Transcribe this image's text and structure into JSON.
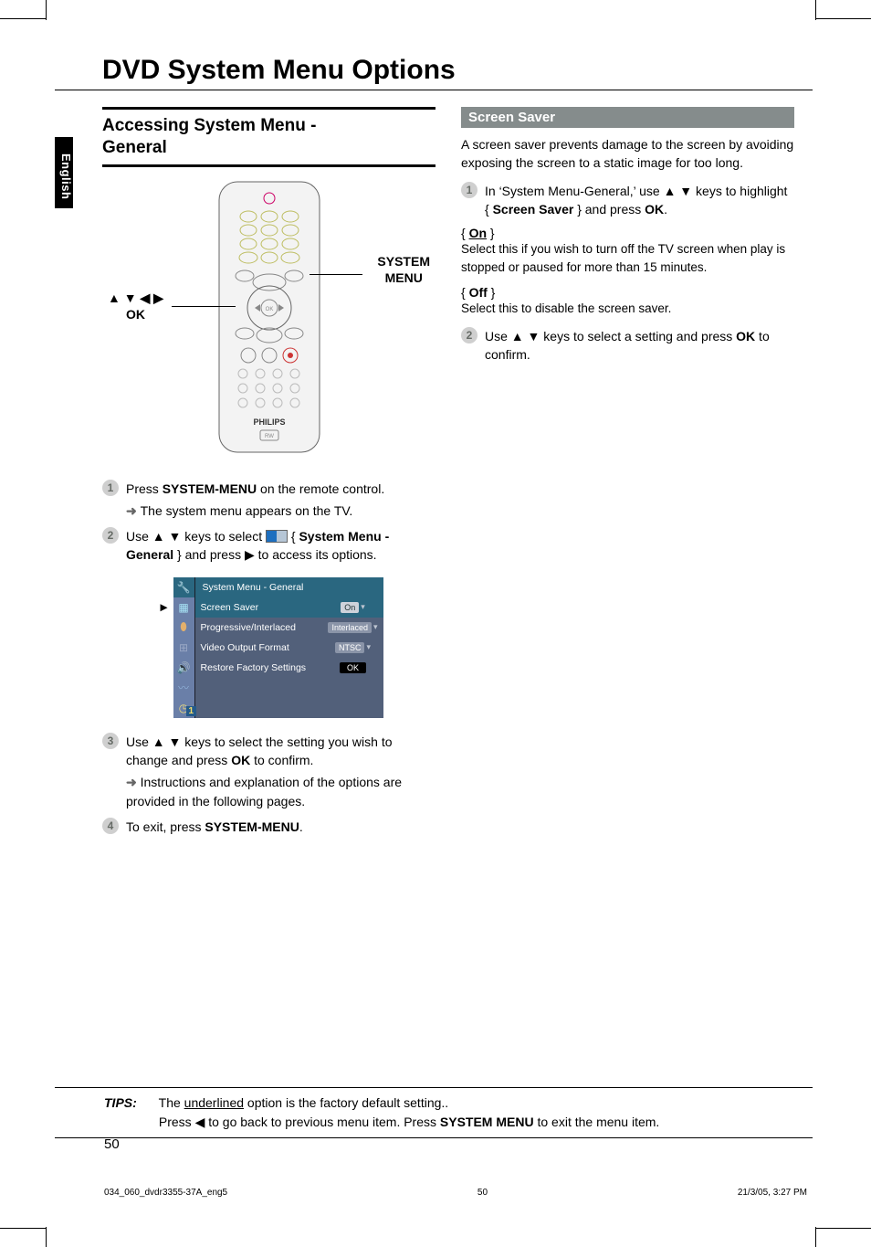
{
  "page_title": "DVD System Menu Options",
  "side_tab": "English",
  "left": {
    "heading_line1": "Accessing System Menu -",
    "heading_line2": "General",
    "fig_label_left_line1": "▲ ▼ ◀ ▶",
    "fig_label_left_line2": "OK",
    "fig_label_right_line1": "SYSTEM",
    "fig_label_right_line2": "MENU",
    "remote_brand": "PHILIPS",
    "step1_a": "Press ",
    "step1_b": "SYSTEM-MENU",
    "step1_c": " on the remote control.",
    "step1_sub_a": "The system menu appears on the TV.",
    "step2_a": "Use ▲ ▼ keys to select ",
    "step2_b": " { ",
    "step2_c": "System Menu - General",
    "step2_d": " } and press ▶ to access its options.",
    "menu": {
      "title": "System Menu - General",
      "rows": [
        {
          "label": "Screen Saver",
          "value": "On",
          "selected": true
        },
        {
          "label": "Progressive/Interlaced",
          "value": "Interlaced",
          "selected": false
        },
        {
          "label": "Video Output Format",
          "value": "NTSC",
          "selected": false
        },
        {
          "label": "Restore Factory Settings",
          "value": "OK",
          "selected": false,
          "ok": true
        }
      ],
      "pointer_row": 0,
      "side_badge": "1"
    },
    "step3_a": "Use ▲ ▼ keys to select the setting you wish to change and press ",
    "step3_b": "OK",
    "step3_c": " to confirm.",
    "step3_sub": "Instructions and explanation of the options are provided in the following pages.",
    "step4_a": "To exit, press ",
    "step4_b": "SYSTEM-MENU",
    "step4_c": "."
  },
  "right": {
    "subhead": "Screen Saver",
    "intro": "A screen saver prevents damage to the screen by avoiding exposing the screen to a static image for too long.",
    "step1_a": "In ‘System Menu-General,’ use ▲ ▼ keys to highlight { ",
    "step1_b": "Screen Saver",
    "step1_c": " } and press ",
    "step1_d": "OK",
    "step1_e": ".",
    "opt_on_label": "On",
    "opt_on_desc": "Select this if you wish to turn off the TV screen when play is stopped or paused for more than 15 minutes.",
    "opt_off_label": "Off",
    "opt_off_desc": "Select this to disable the screen saver.",
    "step2_a": "Use ▲ ▼ keys to select a setting and press ",
    "step2_b": "OK",
    "step2_c": " to confirm."
  },
  "tips": {
    "label": "TIPS:",
    "line1_a": "The ",
    "line1_b": "underlined",
    "line1_c": " option is the factory default setting..",
    "line2_a": "Press ◀ to go back to previous menu item. Press ",
    "line2_b": "SYSTEM MENU",
    "line2_c": " to exit the menu item."
  },
  "page_number": "50",
  "print_footer": {
    "left": "034_060_dvdr3355-37A_eng5",
    "mid": "50",
    "right": "21/3/05, 3:27 PM"
  }
}
